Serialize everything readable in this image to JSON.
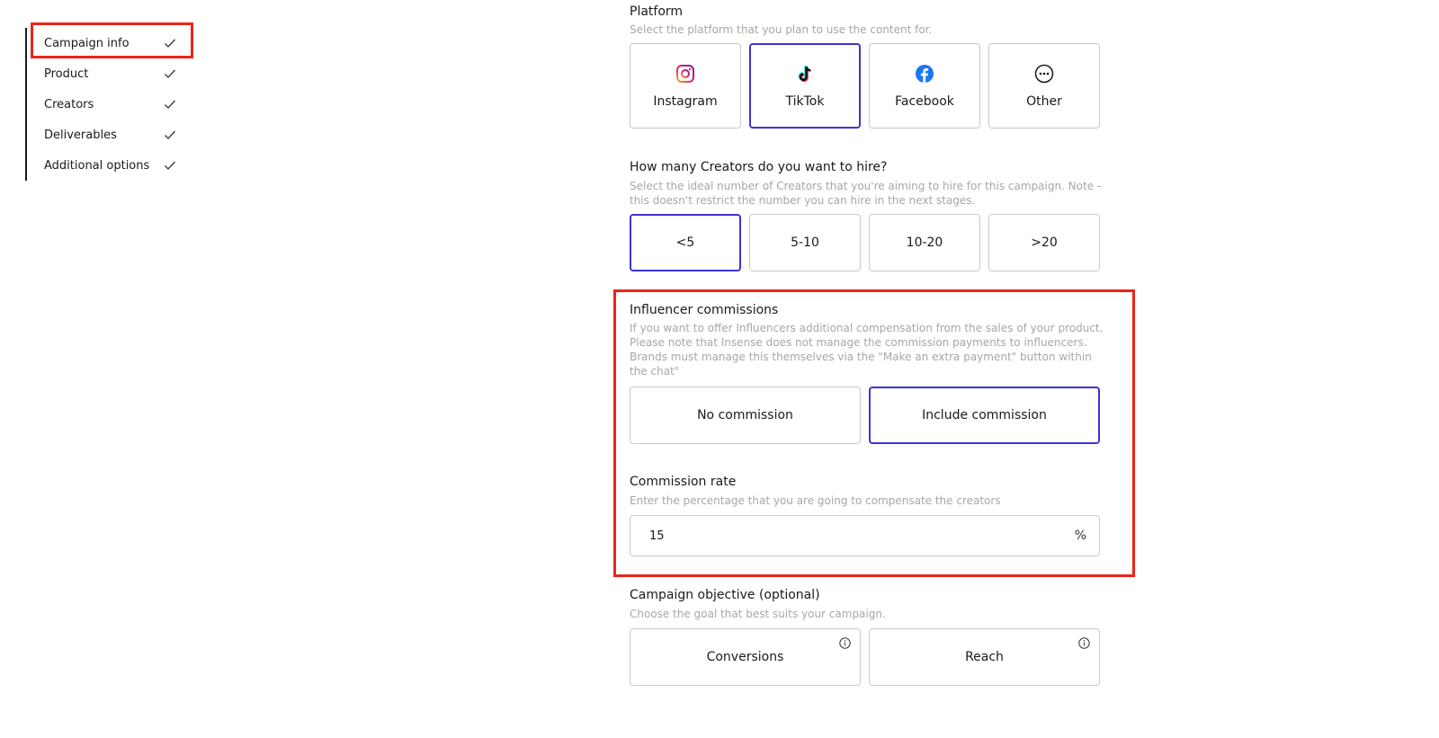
{
  "sidebar": {
    "items": [
      {
        "label": "Campaign info"
      },
      {
        "label": "Product"
      },
      {
        "label": "Creators"
      },
      {
        "label": "Deliverables"
      },
      {
        "label": "Additional options"
      }
    ]
  },
  "platform": {
    "title": "Platform",
    "desc": "Select the platform that you plan to use the content for.",
    "options": [
      {
        "label": "Instagram",
        "icon": "instagram-icon"
      },
      {
        "label": "TikTok",
        "icon": "tiktok-icon",
        "selected": true
      },
      {
        "label": "Facebook",
        "icon": "facebook-icon"
      },
      {
        "label": "Other",
        "icon": "more-icon"
      }
    ]
  },
  "creators": {
    "title": "How many Creators do you want to hire?",
    "desc": "Select the ideal number of Creators that you're aiming to hire for this campaign. Note - this doesn't restrict the number you can hire in the next stages.",
    "options": [
      {
        "label": "<5",
        "selected": true
      },
      {
        "label": "5-10"
      },
      {
        "label": "10-20"
      },
      {
        "label": ">20"
      }
    ]
  },
  "commissions": {
    "title": "Influencer commissions",
    "desc": "If you want to offer Influencers additional compensation from the sales of your product. Please note that Insense does not manage the commission payments to influencers. Brands must manage this themselves via the \"Make an extra payment\" button within the chat\"",
    "options": [
      {
        "label": "No commission"
      },
      {
        "label": "Include commission",
        "selected": true
      }
    ]
  },
  "rate": {
    "title": "Commission rate",
    "desc": "Enter the percentage that you are going to compensate the creators",
    "value": "15",
    "suffix": "%"
  },
  "objective": {
    "title": "Campaign objective",
    "optional": "(optional)",
    "desc": "Choose the goal that best suits your campaign.",
    "options": [
      {
        "label": "Conversions"
      },
      {
        "label": "Reach"
      }
    ]
  },
  "colors": {
    "selected_border": "#3c34d9",
    "highlight": "#ee2417",
    "muted_text": "#a7a7a7"
  }
}
